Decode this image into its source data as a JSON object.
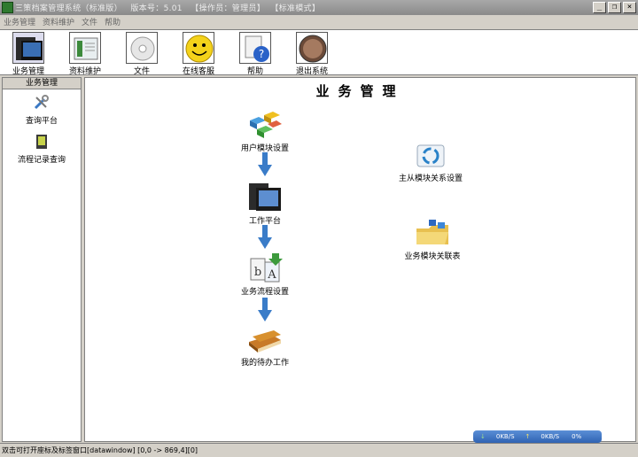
{
  "window": {
    "title": "三策档案管理系统（标准版）   版本号：5.01   【操作员：管理员】  【标准模式】",
    "minimize": "_",
    "restore": "❐",
    "close": "×"
  },
  "menu": [
    "业务管理",
    "资料维护",
    "文件",
    "帮助"
  ],
  "toolbar": [
    {
      "label": "业务管理",
      "icon": "monitor-icon"
    },
    {
      "label": "资料维护",
      "icon": "book-icon"
    },
    {
      "label": "文件",
      "icon": "disc-icon"
    },
    {
      "label": "在线客服",
      "icon": "smiley-icon"
    },
    {
      "label": "帮助",
      "icon": "help-icon"
    },
    {
      "label": "退出系统",
      "icon": "exit-icon"
    }
  ],
  "left_panel": {
    "header": "业务管理",
    "items": [
      {
        "label": "查询平台",
        "icon": "tools-icon"
      },
      {
        "label": "流程记录查询",
        "icon": "record-icon"
      }
    ]
  },
  "main": {
    "title": "业务管理",
    "nodes": [
      {
        "label": "用户模块设置",
        "icon": "modules-icon"
      },
      {
        "label": "工作平台",
        "icon": "monitor-icon"
      },
      {
        "label": "业务流程设置",
        "icon": "flow-icon"
      },
      {
        "label": "我的待办工作",
        "icon": "books-icon"
      },
      {
        "label": "主从模块关系设置",
        "icon": "recycle-icon"
      },
      {
        "label": "业务模块关联表",
        "icon": "folder-icon"
      }
    ]
  },
  "status": {
    "text": "双击可打开座标及标签窗口[datawindow] [0,0 -> 869,4][0]",
    "download": "0KB/S",
    "upload": "0KB/S",
    "percent": "0%"
  }
}
